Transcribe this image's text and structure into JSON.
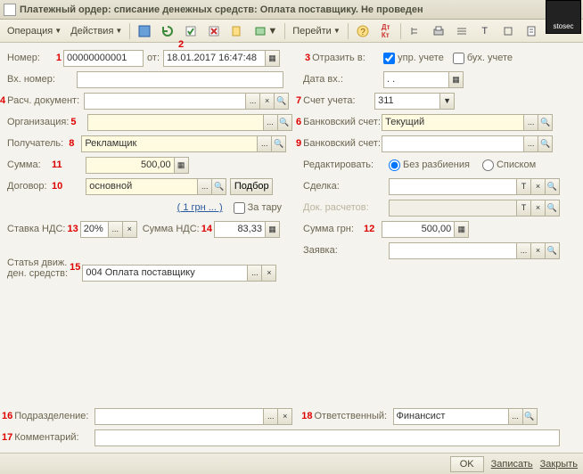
{
  "title": "Платежный ордер: списание денежных средств: Оплата поставщику. Не проведен",
  "logo": "stosec",
  "toolbar": {
    "operation": "Операция",
    "actions": "Действия",
    "goto": "Перейти"
  },
  "labels": {
    "number": "Номер:",
    "from": "от:",
    "ext_number": "Вх. номер:",
    "doc": "Расч. документ:",
    "org": "Организация:",
    "recipient": "Получатель:",
    "sum": "Сумма:",
    "contract": "Договор:",
    "rate_hint": "( 1 грн ... )",
    "tare": "За тару",
    "vat_rate": "Ставка НДС:",
    "vat_sum": "Сумма НДС:",
    "cashflow": "Статья движ.\nден. средств:",
    "subdiv": "Подразделение:",
    "comment": "Комментарий:",
    "reflect": "Отразить в:",
    "mgmt": "упр. учете",
    "acc": "бух. учете",
    "date_in": "Дата вх.:",
    "account": "Счет учета:",
    "bank6": "Банковский счет:",
    "bank9": "Банковский счет:",
    "edit": "Редактировать:",
    "no_split": "Без разбиения",
    "list": "Списком",
    "deal": "Сделка:",
    "settle_doc": "Док. расчетов:",
    "sum_grn": "Сумма грн:",
    "request": "Заявка:",
    "responsible": "Ответственный:",
    "select_btn": "Подбор"
  },
  "values": {
    "number": "00000000001",
    "date": "18.01.2017 16:47:48",
    "date_in": ". .",
    "account": "311",
    "bank6": "Текущий",
    "recipient": "Рекламщик",
    "sum": "500,00",
    "contract": "основной",
    "vat_rate": "20%",
    "vat_sum": "83,33",
    "sum_grn": "500,00",
    "cashflow": "004 Оплата поставщику",
    "responsible": "Финансист"
  },
  "nums": {
    "n1": "1",
    "n2": "2",
    "n3": "3",
    "n4": "4",
    "n5": "5",
    "n6": "6",
    "n7": "7",
    "n8": "8",
    "n9": "9",
    "n10": "10",
    "n11": "11",
    "n12": "12",
    "n13": "13",
    "n14": "14",
    "n15": "15",
    "n16": "16",
    "n17": "17",
    "n18": "18"
  },
  "footer": {
    "ok": "OK",
    "save": "Записать",
    "close": "Закрыть"
  }
}
